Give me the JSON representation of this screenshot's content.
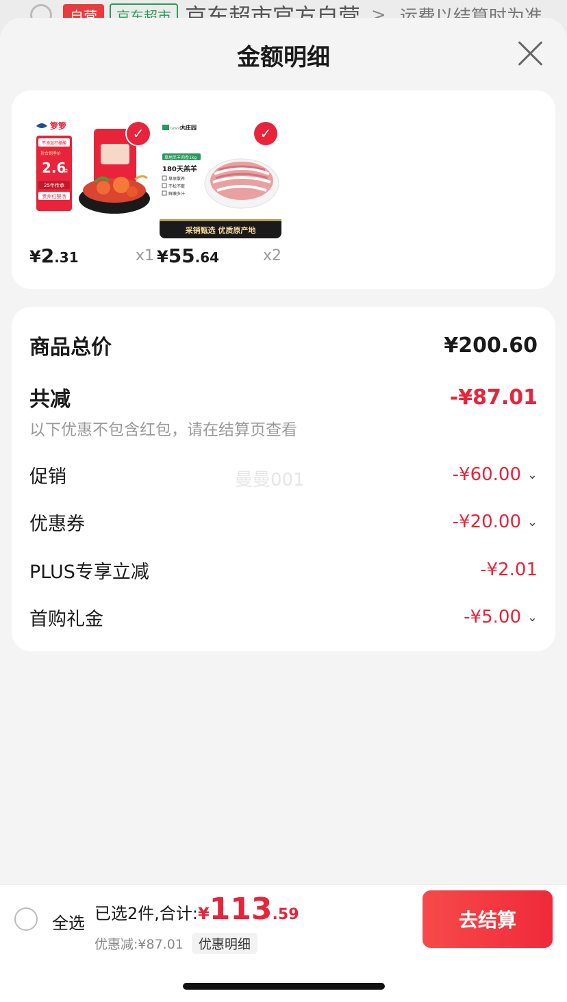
{
  "background_cart": {
    "tag_self": "自营",
    "tag_shop": "京东超市",
    "shop_name": "京东超市官方自营",
    "shop_arrow": ">",
    "shipping_note": "运费以结算时为准"
  },
  "sheet": {
    "title": "金额明细"
  },
  "products": [
    {
      "price_yen": "¥",
      "price_int": "2",
      "price_dec": ".31",
      "qty": "x1",
      "image_text": {
        "brand": "箩箩",
        "badge_top": "不添加柠檬酸",
        "price_label": "折合到手价",
        "price_big": "2.6",
        "per": "/袋",
        "tag1": "25年传承",
        "tag2": "贵州红酸汤"
      }
    },
    {
      "price_yen": "¥",
      "price_int": "55",
      "price_dec": ".64",
      "qty": "x2",
      "image_text": {
        "brand": "大庄园",
        "brand_en": "Grand Farm",
        "tag": "草地羔羊肉卷1kg",
        "headline": "180天羔羊",
        "bullets": [
          "草原散养",
          "不松不散",
          "鲜嫩多汁"
        ],
        "footer": "采销甄选 优质原产地"
      }
    }
  ],
  "summary": {
    "total_label": "商品总价",
    "total_value": "¥200.60",
    "reduce_label": "共减",
    "reduce_value": "-¥87.01",
    "note": "以下优惠不包含红包，请在结算页查看",
    "items": [
      {
        "label": "促销",
        "value": "-¥60.00",
        "has_chevron": true
      },
      {
        "label": "优惠券",
        "value": "-¥20.00",
        "has_chevron": true
      },
      {
        "label": "PLUS专享立减",
        "value": "-¥2.01",
        "has_chevron": false
      },
      {
        "label": "首购礼金",
        "value": "-¥5.00",
        "has_chevron": true
      }
    ],
    "watermark": "曼曼001"
  },
  "bottom_bar": {
    "select_all": "全选",
    "selected_text": "已选2件,合计:",
    "total_yen": "¥",
    "total_int": "113",
    "total_dec": ".59",
    "discount_text": "优惠减:¥87.01",
    "detail_button": "优惠明细",
    "checkout_button": "去结算"
  },
  "colors": {
    "accent_red": "#e8233a",
    "sheet_bg": "#f4f4f4"
  }
}
